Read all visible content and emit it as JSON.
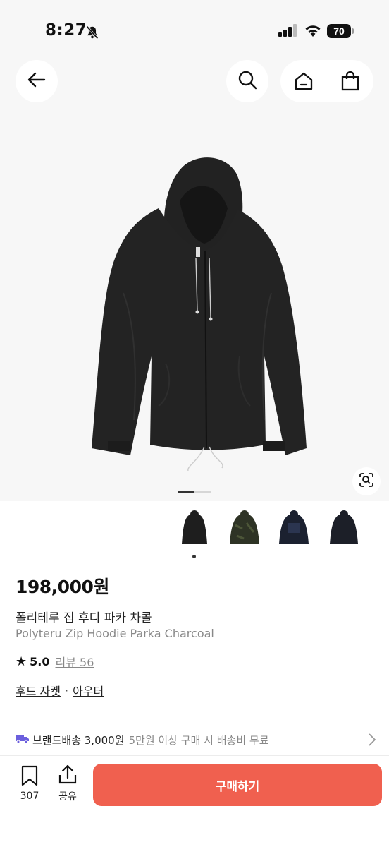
{
  "status_bar": {
    "time": "8:27",
    "battery": "70"
  },
  "product": {
    "price": "198,000원",
    "name_ko": "폴리테루 집 후디 파카 차콜",
    "name_en": "Polyteru Zip Hoodie Parka Charcoal",
    "rating": "5.0",
    "reviews_label": "리뷰 56",
    "category_1": "후드 자켓",
    "category_sep": "·",
    "category_2": "아우터",
    "image_index": 1,
    "image_count": 4
  },
  "shipping": {
    "label": "브랜드배송 3,000원",
    "note": "5만원 이상 구매 시 배송비 무료"
  },
  "actions": {
    "bookmark_count": "307",
    "share_label": "공유",
    "buy_label": "구매하기"
  },
  "colors": {
    "accent": "#f0604f",
    "background": "#f7f7f7",
    "ship_icon": "#6b5fdd"
  },
  "icons": [
    "back-arrow-icon",
    "search-icon",
    "home-icon",
    "shopping-bag-icon",
    "visual-search-icon",
    "truck-icon",
    "chevron-right-icon",
    "bookmark-icon",
    "share-icon",
    "star-icon",
    "bell-slash-icon"
  ]
}
